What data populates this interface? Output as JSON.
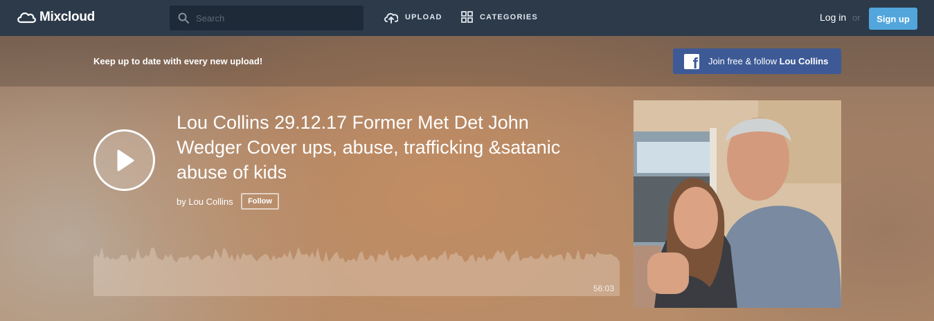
{
  "nav": {
    "logo_text": "Mixcloud",
    "search_placeholder": "Search",
    "upload_label": "UPLOAD",
    "categories_label": "CATEGORIES",
    "login_label": "Log in",
    "or_label": "or",
    "signup_label": "Sign up"
  },
  "banner": {
    "text": "Keep up to date with every new upload!",
    "fb_prefix": "Join free & follow ",
    "fb_name": "Lou Collins"
  },
  "show": {
    "title": "Lou Collins 29.12.17 Former Met Det John Wedger Cover ups, abuse, trafficking &satanic abuse of kids",
    "by_label": "by Lou Collins",
    "follow_label": "Follow",
    "duration": "56:03"
  },
  "colors": {
    "nav_bg": "#2c3a4a",
    "signup_bg": "#52a6dc",
    "facebook_blue": "#3d5a96"
  }
}
